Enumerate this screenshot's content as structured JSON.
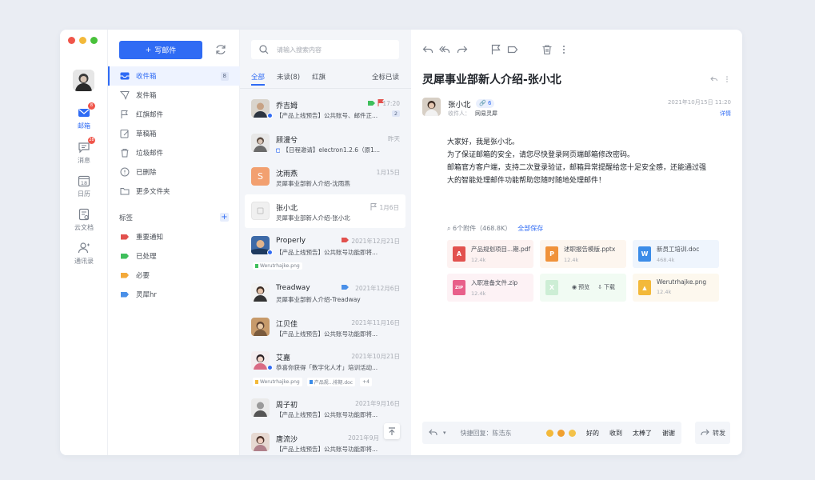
{
  "window": {
    "controls": [
      "#f0554a",
      "#f3b93a",
      "#48c13a"
    ]
  },
  "rail": {
    "items": [
      {
        "label": "邮箱",
        "icon": "mail-icon",
        "badge": "8",
        "active": true
      },
      {
        "label": "消息",
        "icon": "message-icon",
        "badge": "28"
      },
      {
        "label": "日历",
        "icon": "calendar-icon",
        "day": "18"
      },
      {
        "label": "云文档",
        "icon": "cloud-doc-icon"
      },
      {
        "label": "通讯录",
        "icon": "contacts-icon"
      }
    ]
  },
  "folders": {
    "compose_label": "写邮件",
    "items": [
      {
        "label": "收件箱",
        "count": "8",
        "active": true
      },
      {
        "label": "发件箱"
      },
      {
        "label": "红旗邮件"
      },
      {
        "label": "草稿箱"
      },
      {
        "label": "垃圾邮件"
      },
      {
        "label": "已删除"
      },
      {
        "label": "更多文件夹"
      }
    ],
    "labels_title": "标签",
    "add_label": "+",
    "tags": [
      {
        "label": "重要通知",
        "color": "#e2514e"
      },
      {
        "label": "已处理",
        "color": "#3fbf5c"
      },
      {
        "label": "必要",
        "color": "#f3a93a"
      },
      {
        "label": "灵犀hr",
        "color": "#4a90e8"
      }
    ]
  },
  "list": {
    "search_placeholder": "请输入搜索内容",
    "tabs": [
      {
        "label": "全部",
        "active": true
      },
      {
        "label": "未读(8)"
      },
      {
        "label": "红旗"
      }
    ],
    "mark_all": "全标已读",
    "rows": [
      {
        "name": "乔吉姆",
        "time": "17:20",
        "subject": "【产品上线预告】公共账号、邮件正...",
        "count": "2"
      },
      {
        "name": "顾漫兮",
        "time": "昨天",
        "subject": "【日程邀请】electron1.2.6（原1..."
      },
      {
        "name": "沈雨燕",
        "time": "1月15日",
        "subject": "灵犀事业部新人介绍-沈雨燕",
        "initial": "S"
      },
      {
        "name": "张小北",
        "time": "1月6日",
        "subject": "灵犀事业部新人介绍-张小北"
      },
      {
        "name": "Properly",
        "time": "2021年12月21日",
        "subject": "【产品上线预告】公共账号功能即将...",
        "attachments": [
          "Werutrhajke.png"
        ]
      },
      {
        "name": "Treadway",
        "time": "2021年12月6日",
        "subject": "灵犀事业部新人介绍-Treadway"
      },
      {
        "name": "江贝佳",
        "time": "2021年11月16日",
        "subject": "【产品上线预告】公共账号功能即将..."
      },
      {
        "name": "艾嘉",
        "time": "2021年10月21日",
        "subject": "恭喜你获得「数字化人才」培训活动...",
        "attachments": [
          "Werutrhajke.png",
          "产品规...排期.doc",
          "+4"
        ]
      },
      {
        "name": "周子初",
        "time": "2021年9月16日",
        "subject": "【产品上线预告】公共账号功能即将..."
      },
      {
        "name": "唐流沙",
        "time": "2021年9月",
        "subject": "【产品上线预告】公共账号功能即将..."
      }
    ]
  },
  "reader": {
    "subject": "灵犀事业部新人介绍-张小北",
    "sender": "张小北",
    "sender_count": "6",
    "recipient_label": "收件人：",
    "recipient": "网易灵犀",
    "datetime": "2021年10月15日 11:20",
    "detail": "详情",
    "body": [
      "大家好，我是张小北。",
      "为了保证邮箱的安全，请您尽快登录网页端邮箱修改密码。",
      "邮箱官方客户端，支持二次登录验证，邮箱异常提醒给您十足安全感，还能通过强",
      "大的智能处理邮件功能帮助您随时随地处理邮件！"
    ],
    "attach_summary": "6个附件（468.8K）",
    "save_all": "全部保存",
    "files": [
      {
        "name": "产品规划项目...期.pdf",
        "size": "12.4k",
        "icon": "pdf-icon",
        "color": "#e2514e",
        "bg": "#fdf2f1",
        "glyph": "A"
      },
      {
        "name": "述职报告模版.pptx",
        "size": "12.4k",
        "icon": "ppt-icon",
        "color": "#f0923a",
        "bg": "#fdf6ef",
        "glyph": "P"
      },
      {
        "name": "新员工培训.doc",
        "size": "468.4k",
        "icon": "word-icon",
        "color": "#3b8ce8",
        "bg": "#eff5fd",
        "glyph": "W"
      },
      {
        "name": "入职准备文件.zip",
        "size": "12.4k",
        "icon": "zip-icon",
        "color": "#e8608a",
        "bg": "#fdf2f5",
        "glyph": "ZIP"
      },
      {
        "name": "",
        "size": "",
        "icon": "excel-icon",
        "color": "#3fbf5c",
        "bg": "#f1fbf3",
        "glyph": "X",
        "hover": true,
        "preview": "预览",
        "download": "下载"
      },
      {
        "name": "Werutrhajke.png",
        "size": "12.4k",
        "icon": "image-icon",
        "color": "#f3b93a",
        "bg": "#fdf8ee",
        "glyph": "▲"
      }
    ],
    "quick_reply_placeholder": "快捷回复：陈浩东",
    "quick_words": [
      "好的",
      "收到",
      "太棒了",
      "谢谢"
    ],
    "forward_label": "转发"
  }
}
